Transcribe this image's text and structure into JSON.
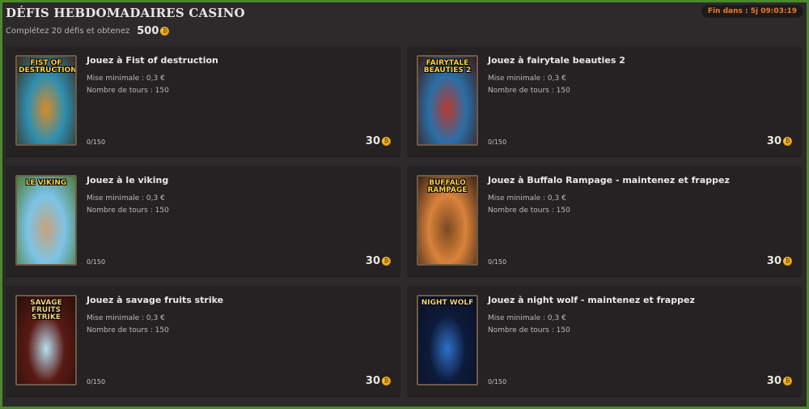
{
  "header": {
    "title": "DÉFIS HEBDOMADAIRES CASINO",
    "subtitle": "Complétez 20 défis et obtenez",
    "reward": "500",
    "timer": "Fin dans : 5j 09:03:19"
  },
  "coin_symbol": "₿",
  "challenges": [
    {
      "title": "Jouez à Fist of destruction",
      "min_bet": "Mise minimale : 0,3 €",
      "turns": "Nombre de tours : 150",
      "progress": "0/150",
      "points": "30",
      "thumb_label": "FIST OF DESTRUCTION",
      "colors": [
        "#2f8fb0",
        "#d98a28",
        "#3a2a1c"
      ]
    },
    {
      "title": "Jouez à fairytale beauties 2",
      "min_bet": "Mise minimale : 0,3 €",
      "turns": "Nombre de tours : 150",
      "progress": "0/150",
      "points": "30",
      "thumb_label": "FAIRYTALE BEAUTIES 2",
      "colors": [
        "#2b6fa6",
        "#b8392e",
        "#3a1a18"
      ]
    },
    {
      "title": "Jouez à le viking",
      "min_bet": "Mise minimale : 0,3 €",
      "turns": "Nombre de tours : 150",
      "progress": "0/150",
      "points": "30",
      "thumb_label": "LE VIKING",
      "colors": [
        "#7cc4e8",
        "#c7a27a",
        "#4c7a3a"
      ]
    },
    {
      "title": "Jouez à Buffalo Rampage - maintenez et frappez",
      "min_bet": "Mise minimale : 0,3 €",
      "turns": "Nombre de tours : 150",
      "progress": "0/150",
      "points": "30",
      "thumb_label": "BUFFALO RAMPAGE",
      "colors": [
        "#d9823a",
        "#7a4a22",
        "#3a2418"
      ]
    },
    {
      "title": "Jouez à savage fruits strike",
      "min_bet": "Mise minimale : 0,3 €",
      "turns": "Nombre de tours : 150",
      "progress": "0/150",
      "points": "30",
      "thumb_label": "SAVAGE FRUITS STRIKE",
      "colors": [
        "#5a1a14",
        "#b8dff0",
        "#2a0f0c"
      ]
    },
    {
      "title": "Jouez à night wolf - maintenez et frappez",
      "min_bet": "Mise minimale : 0,3 €",
      "turns": "Nombre de tours : 150",
      "progress": "0/150",
      "points": "30",
      "thumb_label": "NIGHT WOLF",
      "colors": [
        "#0d1a3a",
        "#2f6fc8",
        "#0a1226"
      ]
    }
  ]
}
